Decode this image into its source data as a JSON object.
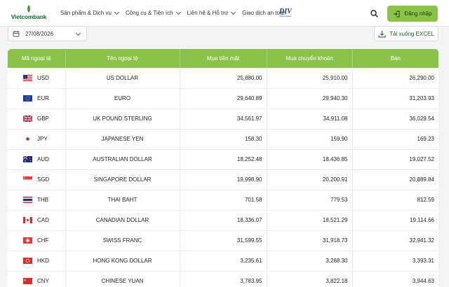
{
  "header": {
    "logo_text": "Vietcombank",
    "nav": [
      {
        "label": "Sản phẩm & Dịch vụ",
        "has_dropdown": true
      },
      {
        "label": "Công cụ & Tiện ích",
        "has_dropdown": true
      },
      {
        "label": "Liên hệ & Hỗ trợ",
        "has_dropdown": true
      },
      {
        "label": "Giao dịch an toàn",
        "has_dropdown": false
      }
    ],
    "partner_logo": {
      "big": "DIV",
      "small": "Vietcombank"
    },
    "search_icon": "search-icon",
    "login_label": "Đăng nhập",
    "login_icon": "login-icon"
  },
  "toolbar": {
    "date_value": "27/08/2026",
    "date_icon": "calendar-icon",
    "excel_label": "Tải xuống EXCEL",
    "excel_icon": "download-icon"
  },
  "table": {
    "headers": [
      "Mã ngoại tệ",
      "Tên ngoại tệ",
      "Mua tiền mặt",
      "Mua chuyển khoản",
      "Bán"
    ],
    "rows": [
      {
        "code": "USD",
        "name": "US DOLLAR",
        "cash": "25,880.00",
        "transfer": "25,910.00",
        "sell": "26,290.00",
        "flag": "us-flag-icon"
      },
      {
        "code": "EUR",
        "name": "EURO",
        "cash": "29,640.89",
        "transfer": "29,940.30",
        "sell": "31,203.93",
        "flag": "eu-flag-icon"
      },
      {
        "code": "GBP",
        "name": "UK POUND STERLING",
        "cash": "34,561.97",
        "transfer": "34,911.08",
        "sell": "36,029.54",
        "flag": "uk-flag-icon"
      },
      {
        "code": "JPY",
        "name": "JAPANESE YEN",
        "cash": "158.30",
        "transfer": "159.90",
        "sell": "169.23",
        "flag": "jp-flag-icon"
      },
      {
        "code": "AUD",
        "name": "AUSTRALIAN DOLLAR",
        "cash": "18,252.48",
        "transfer": "18,436.85",
        "sell": "19,027.52",
        "flag": "au-flag-icon"
      },
      {
        "code": "SGD",
        "name": "SINGAPORE DOLLAR",
        "cash": "19,998.90",
        "transfer": "20,200.91",
        "sell": "20,889.84",
        "flag": "sg-flag-icon"
      },
      {
        "code": "THB",
        "name": "THAI BAHT",
        "cash": "701.58",
        "transfer": "779.53",
        "sell": "812.59",
        "flag": "th-flag-icon"
      },
      {
        "code": "CAD",
        "name": "CANADIAN DOLLAR",
        "cash": "18,336.07",
        "transfer": "18,521.29",
        "sell": "19,114.66",
        "flag": "ca-flag-icon"
      },
      {
        "code": "CHF",
        "name": "SWISS FRANC",
        "cash": "31,599.55",
        "transfer": "31,918.73",
        "sell": "32,941.32",
        "flag": "ch-flag-icon"
      },
      {
        "code": "HKD",
        "name": "HONG KONG DOLLAR",
        "cash": "3,235.61",
        "transfer": "3,268.30",
        "sell": "3,393.31",
        "flag": "hk-flag-icon"
      },
      {
        "code": "CNY",
        "name": "CHINESE YUAN",
        "cash": "3,783.95",
        "transfer": "3,822.18",
        "sell": "3,944.63",
        "flag": "cn-flag-icon"
      }
    ]
  },
  "colors": {
    "accent": "#8bc34a",
    "brand": "#0a6b36"
  }
}
